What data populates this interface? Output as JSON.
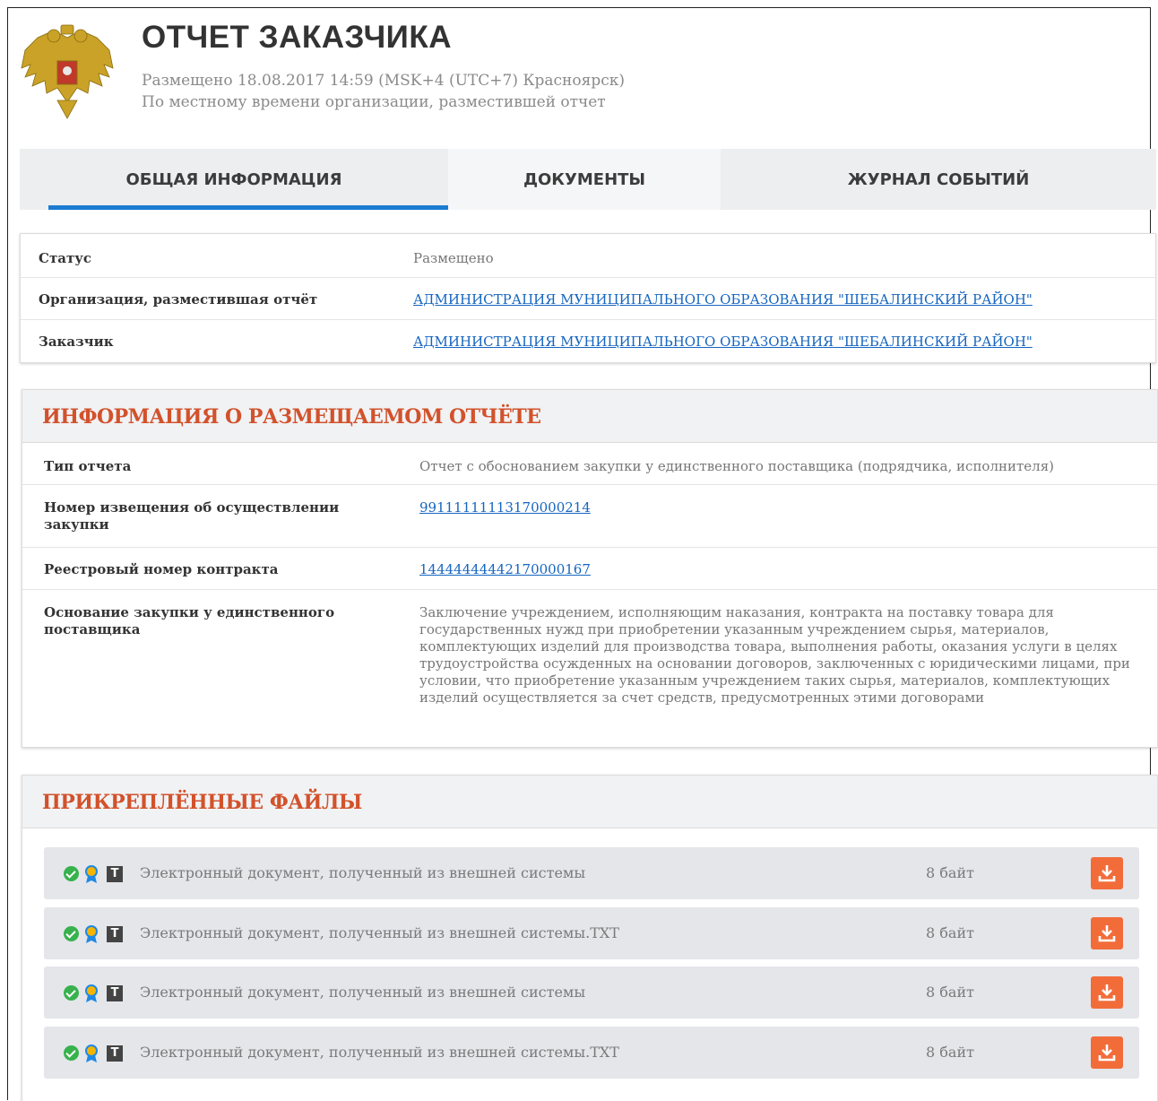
{
  "header": {
    "title": "ОТЧЕТ ЗАКАЗЧИКА",
    "posted": "Размещено 18.08.2017 14:59 (MSK+4 (UTC+7) Красноярск)",
    "timezone_note": "По местному времени организации, разместившей отчет"
  },
  "tabs": [
    {
      "label": "ОБЩАЯ ИНФОРМАЦИЯ",
      "active": true
    },
    {
      "label": "ДОКУМЕНТЫ",
      "active": false
    },
    {
      "label": "ЖУРНАЛ СОБЫТИЙ",
      "active": false
    }
  ],
  "general": {
    "rows": [
      {
        "label": "Статус",
        "value": "Размещено"
      },
      {
        "label": "Организация, разместившая отчёт",
        "value": "АДМИНИСТРАЦИЯ МУНИЦИПАЛЬНОГО ОБРАЗОВАНИЯ \"ШЕБАЛИНСКИЙ РАЙОН\""
      },
      {
        "label": "Заказчик",
        "value": "АДМИНИСТРАЦИЯ МУНИЦИПАЛЬНОГО ОБРАЗОВАНИЯ \"ШЕБАЛИНСКИЙ РАЙОН\""
      }
    ]
  },
  "report_info": {
    "title": "ИНФОРМАЦИЯ О РАЗМЕЩАЕМОМ ОТЧЁТЕ",
    "rows": [
      {
        "label": "Тип отчета",
        "value": "Отчет с обоснованием закупки у единственного поставщика (подрядчика, исполнителя)"
      },
      {
        "label": "Номер извещения об осуществлении закупки",
        "value": "99111111113170000214"
      },
      {
        "label": "Реестровый номер контракта",
        "value": "14444444442170000167"
      },
      {
        "label": "Основание закупки у единственного поставщика",
        "value": "Заключение учреждением, исполняющим наказания, контракта на поставку товара для государственных нужд при приобретении указанным учреждением сырья, материалов, комплектующих изделий для производства товара, выполнения работы, оказания услуги в целях трудоустройства осужденных на основании договоров, заключенных с юридическими лицами, при условии, что приобретение указанным учреждением таких сырья, материалов, комплектующих изделий осуществляется за счет средств, предусмотренных этими договорами"
      }
    ]
  },
  "attachments": {
    "title": "ПРИКРЕПЛЁННЫЕ ФАЙЛЫ",
    "files": [
      {
        "name": "Электронный документ, полученный из внешней системы",
        "size": "8 байт"
      },
      {
        "name": "Электронный документ, полученный из внешней системы.TXT",
        "size": "8 байт"
      },
      {
        "name": "Электронный документ, полученный из внешней системы",
        "size": "8 байт"
      },
      {
        "name": "Электронный документ, полученный из внешней системы.TXT",
        "size": "8 байт"
      }
    ]
  },
  "colors": {
    "accent_tab": "#1a7bd2",
    "section_title": "#d2522b",
    "link": "#1565c0",
    "download": "#f26c3a",
    "verified": "#37b24d"
  }
}
